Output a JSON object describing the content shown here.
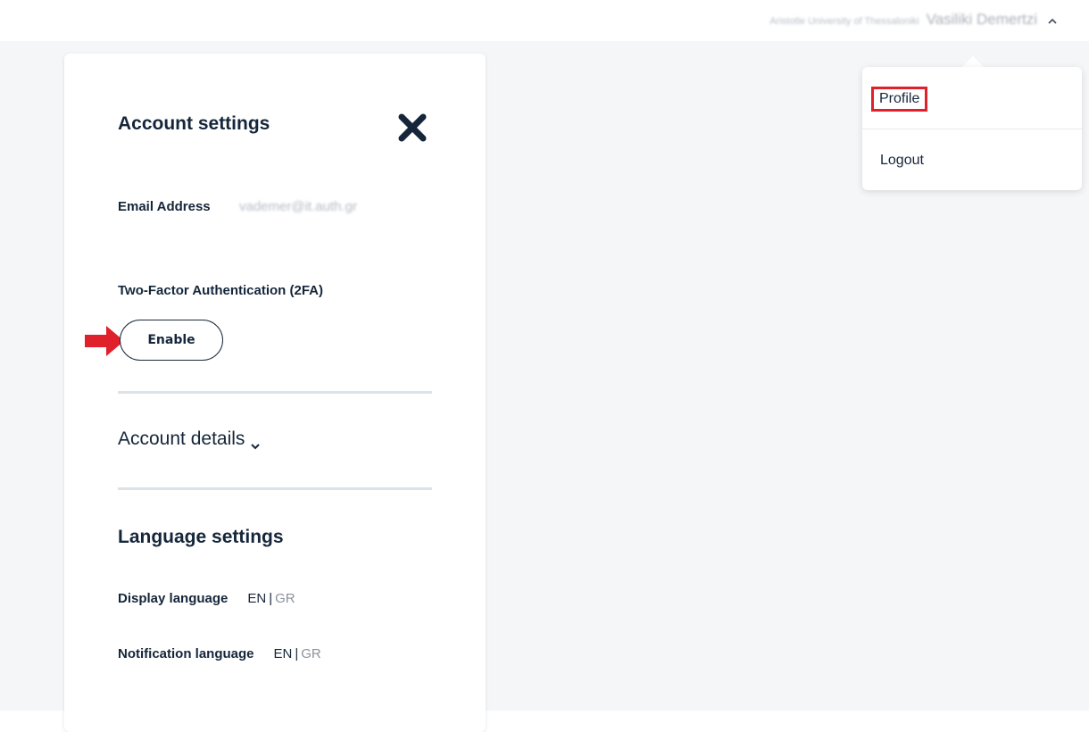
{
  "header": {
    "organization": "Aristotle University of Thessaloniki",
    "user_name": "Vasiliki Demertzi",
    "caret_icon": "chevron-up-icon"
  },
  "user_menu": {
    "items": [
      {
        "label": "Profile"
      },
      {
        "label": "Logout"
      }
    ],
    "highlight_color": "#e0202a"
  },
  "account_panel": {
    "title": "Account settings",
    "close_icon": "close-icon",
    "email": {
      "label": "Email Address",
      "value": "vademer@it.auth.gr"
    },
    "two_factor": {
      "label": "Two-Factor Authentication (2FA)",
      "button_label": "Enable",
      "pointer_icon": "red-arrow-icon"
    },
    "account_details": {
      "label": "Account details",
      "toggle_icon": "chevron-down-icon"
    },
    "language": {
      "title": "Language settings",
      "display": {
        "label": "Display language",
        "active": "EN",
        "separator": "|",
        "inactive": "GR"
      },
      "notification": {
        "label": "Notification language",
        "active": "EN",
        "separator": "|",
        "inactive": "GR"
      }
    }
  },
  "colors": {
    "text": "#15263a",
    "muted": "#8a939d",
    "accent_red": "#e0202a"
  }
}
